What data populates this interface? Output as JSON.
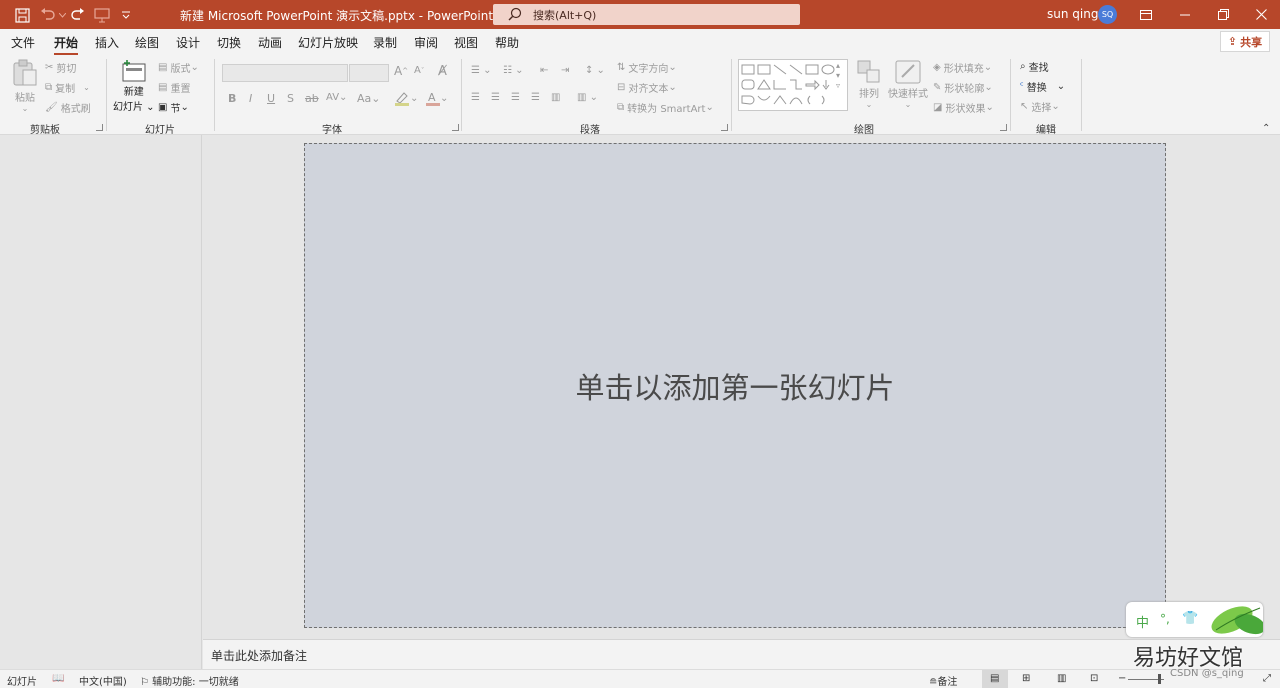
{
  "titlebar": {
    "doc_title": "新建 Microsoft PowerPoint 演示文稿.pptx  -  PowerPoint",
    "search_placeholder": "搜索(Alt+Q)",
    "user_name": "sun qing",
    "avatar_initials": "SQ"
  },
  "menu": {
    "tabs": [
      "文件",
      "开始",
      "插入",
      "绘图",
      "设计",
      "切换",
      "动画",
      "幻灯片放映",
      "录制",
      "审阅",
      "视图",
      "帮助"
    ],
    "active": "开始",
    "share_label": "共享"
  },
  "ribbon": {
    "clipboard": {
      "paste": "粘贴",
      "cut": "剪切",
      "copy": "复制",
      "format_painter": "格式刷",
      "label": "剪贴板"
    },
    "slides": {
      "new_slide_1": "新建",
      "new_slide_2": "幻灯片",
      "layout": "版式",
      "reset": "重置",
      "section": "节",
      "label": "幻灯片"
    },
    "font": {
      "label": "字体",
      "bold": "B",
      "italic": "I",
      "underline": "U",
      "shadow": "S",
      "strike": "ab",
      "spacing": "AV",
      "case": "Aa",
      "grow": "A",
      "shrink": "A"
    },
    "paragraph": {
      "text_direction": "文字方向",
      "align_text": "对齐文本",
      "smartart": "转换为 SmartArt",
      "label": "段落"
    },
    "drawing": {
      "arrange": "排列",
      "quick_styles": "快速样式",
      "fill": "形状填充",
      "outline": "形状轮廓",
      "effects": "形状效果",
      "label": "绘图"
    },
    "editing": {
      "find": "查找",
      "replace": "替换",
      "select": "选择",
      "label": "编辑"
    }
  },
  "slide": {
    "placeholder": "单击以添加第一张幻灯片"
  },
  "notes": {
    "placeholder": "单击此处添加备注"
  },
  "status": {
    "slide": "幻灯片",
    "lang": "中文(中国)",
    "accessibility": "辅助功能: 一切就绪",
    "notes": "备注"
  },
  "ime": {
    "mode": "中",
    "punct": "°,"
  },
  "watermark": {
    "text": "易坊好文馆",
    "small": "CSDN @s_qing"
  },
  "colors": {
    "accent": "#b7472a",
    "slide_bg": "#d0d4dc"
  }
}
